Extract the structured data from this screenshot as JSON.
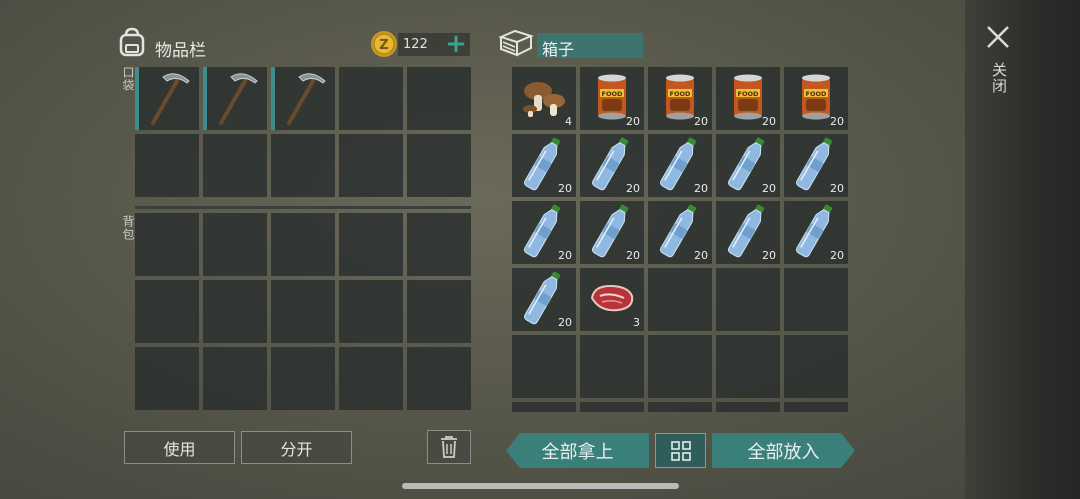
{
  "inventory": {
    "title": "物品栏",
    "pocket_label": "口袋",
    "backpack_label": "背包"
  },
  "currency": {
    "amount": "122",
    "add_symbol": "+"
  },
  "container": {
    "name": "箱子"
  },
  "close": {
    "label": "关闭"
  },
  "buttons": {
    "use": "使用",
    "split": "分开",
    "take_all": "全部拿上",
    "put_all": "全部放入"
  },
  "pocket_items": [
    "pickaxe-icon",
    "pickaxe-icon",
    "pickaxe-icon"
  ],
  "container_slots": [
    {
      "item": "mushroom-icon",
      "count": "4"
    },
    {
      "item": "canned-food-icon",
      "count": "20"
    },
    {
      "item": "canned-food-icon",
      "count": "20"
    },
    {
      "item": "canned-food-icon",
      "count": "20"
    },
    {
      "item": "canned-food-icon",
      "count": "20"
    },
    {
      "item": "water-bottle-icon",
      "count": "20"
    },
    {
      "item": "water-bottle-icon",
      "count": "20"
    },
    {
      "item": "water-bottle-icon",
      "count": "20"
    },
    {
      "item": "water-bottle-icon",
      "count": "20"
    },
    {
      "item": "water-bottle-icon",
      "count": "20"
    },
    {
      "item": "water-bottle-icon",
      "count": "20"
    },
    {
      "item": "water-bottle-icon",
      "count": "20"
    },
    {
      "item": "water-bottle-icon",
      "count": "20"
    },
    {
      "item": "water-bottle-icon",
      "count": "20"
    },
    {
      "item": "water-bottle-icon",
      "count": "20"
    },
    {
      "item": "water-bottle-icon",
      "count": "20"
    },
    {
      "item": "raw-meat-icon",
      "count": "3"
    }
  ],
  "colors": {
    "accent": "#3a7f79",
    "name_field": "#3e7470",
    "add": "#3fa08f"
  }
}
